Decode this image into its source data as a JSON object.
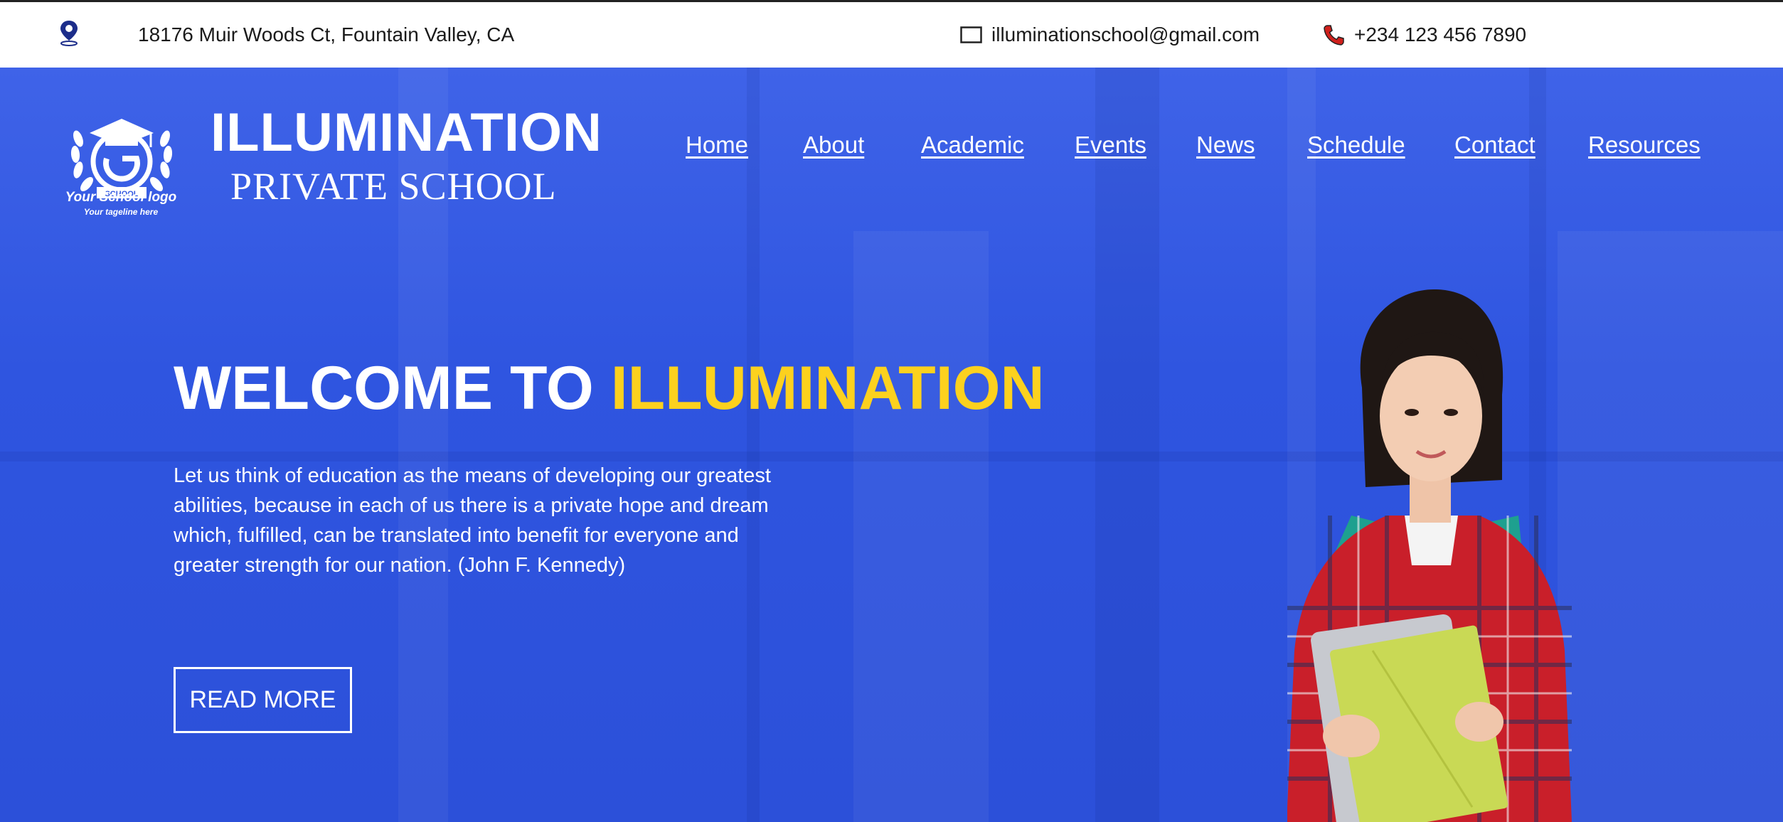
{
  "topbar": {
    "address": "18176 Muir Woods Ct, Fountain Valley, CA",
    "email": "illuminationschool@gmail.com",
    "phone": "+234 123 456 7890"
  },
  "logo": {
    "badge_text": "SCHOOL",
    "caption": "Your School logo",
    "tagline": "Your tageline here"
  },
  "brand": {
    "line1": "ILLUMINATION",
    "line2": "PRIVATE SCHOOL"
  },
  "nav": {
    "items": [
      "Home",
      "About",
      "Academic",
      "Events",
      "News",
      "Schedule",
      "Contact",
      "Resources"
    ]
  },
  "hero": {
    "headline_white": "WELCOME TO ",
    "headline_accent": "ILLUMINATION",
    "quote": "Let us think of education as the means of developing our greatest abilities, because in each of us there is a private hope and dream which, fulfilled, can be translated into benefit for everyone and greater strength for our nation. (John F. Kennedy)",
    "button": "READ MORE"
  },
  "colors": {
    "hero_blue": "#2f55e0",
    "accent_yellow": "#fcd11e",
    "icon_navy": "#1c2d8a",
    "phone_red": "#d0201c"
  },
  "icons": [
    "location-pin-icon",
    "mail-icon",
    "phone-icon",
    "graduation-cap-icon",
    "laurel-wreath-icon"
  ]
}
